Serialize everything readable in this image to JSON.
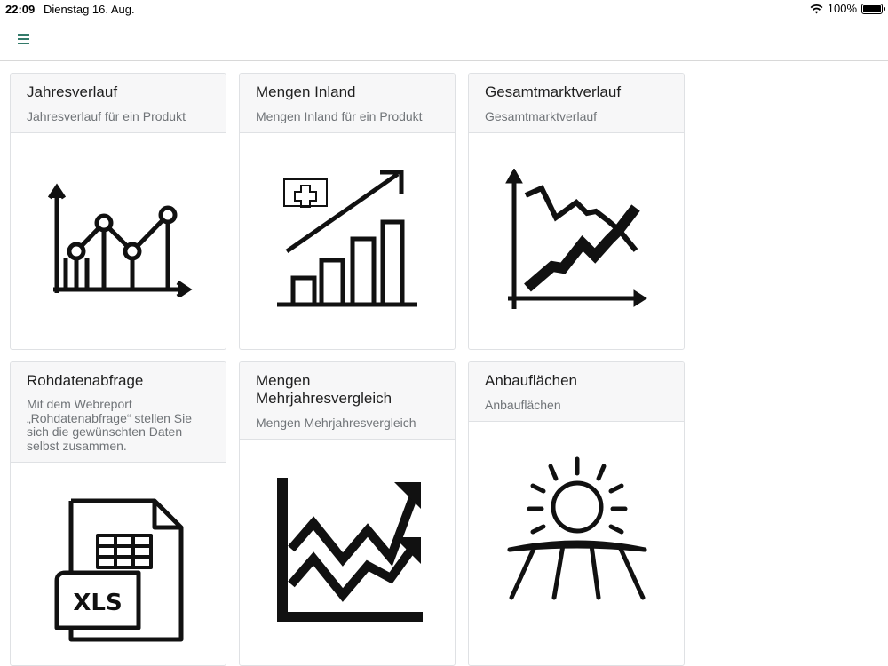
{
  "status": {
    "time": "22:09",
    "date": "Dienstag 16. Aug.",
    "battery": "100%"
  },
  "nav": {
    "menu_icon": "hamburger-icon"
  },
  "accent": "#1e6b5a",
  "cards": [
    {
      "title": "Jahresverlauf",
      "subtitle": "Jahresverlauf für ein Produkt",
      "icon": "line-chart-icon"
    },
    {
      "title": "Mengen Inland",
      "subtitle": "Mengen Inland für ein Produkt",
      "icon": "swiss-bar-chart-icon"
    },
    {
      "title": "Gesamtmarktverlauf",
      "subtitle": "Gesamtmarktverlauf",
      "icon": "market-chart-icon"
    },
    {
      "title": "Rohdatenabfrage",
      "subtitle": "Mit dem Webreport „Rohdatenabfrage“ stellen Sie sich die gewünschten Daten selbst zusammen.",
      "icon": "xls-file-icon"
    },
    {
      "title": "Mengen Mehrjahresvergleich",
      "subtitle": "Mengen Mehrjahresvergleich",
      "icon": "trend-arrows-icon"
    },
    {
      "title": "Anbauflächen",
      "subtitle": "Anbauflächen",
      "icon": "sun-field-icon"
    }
  ]
}
